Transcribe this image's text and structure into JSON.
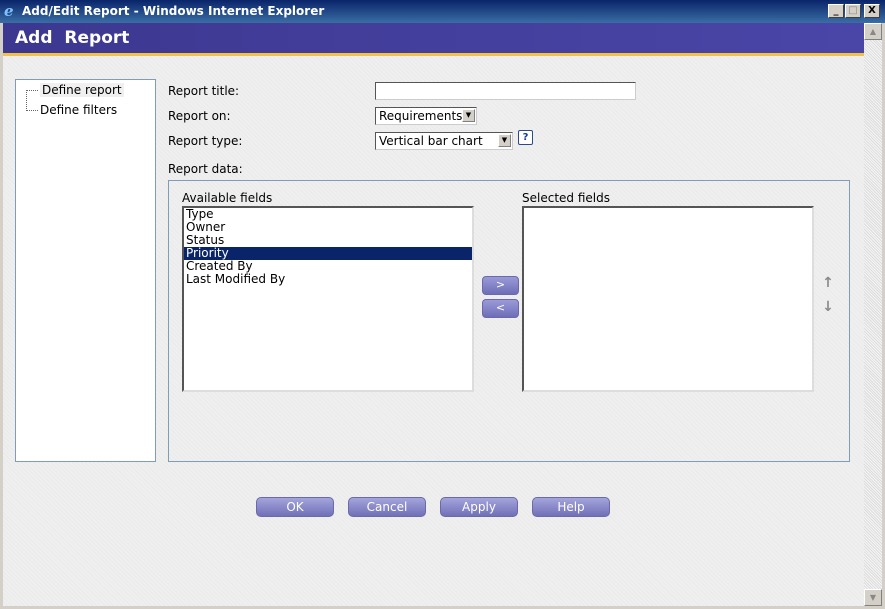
{
  "window": {
    "title": "Add/Edit Report - Windows Internet Explorer",
    "controls": {
      "minimize": "_",
      "maximize": "□",
      "close": "X"
    }
  },
  "header": {
    "title": "Add Report"
  },
  "tree": {
    "items": [
      {
        "label": "Define report",
        "selected": true
      },
      {
        "label": "Define filters",
        "selected": false
      }
    ]
  },
  "form": {
    "report_title_label": "Report title:",
    "report_title_value": "",
    "report_on_label": "Report on:",
    "report_on_value": "Requirements",
    "report_type_label": "Report type:",
    "report_type_value": "Vertical bar chart",
    "help_icon_glyph": "?",
    "report_data_label": "Report data:"
  },
  "fields": {
    "available_label": "Available fields",
    "available": [
      "Type",
      "Owner",
      "Status",
      "Priority",
      "Created By",
      "Last Modified By"
    ],
    "selected_item": "Priority",
    "selected_label": "Selected fields",
    "selected": [],
    "add_button": ">",
    "remove_button": "<",
    "move_up_icon": "↑",
    "move_down_icon": "↓"
  },
  "buttons": {
    "ok": "OK",
    "cancel": "Cancel",
    "apply": "Apply",
    "help": "Help"
  }
}
